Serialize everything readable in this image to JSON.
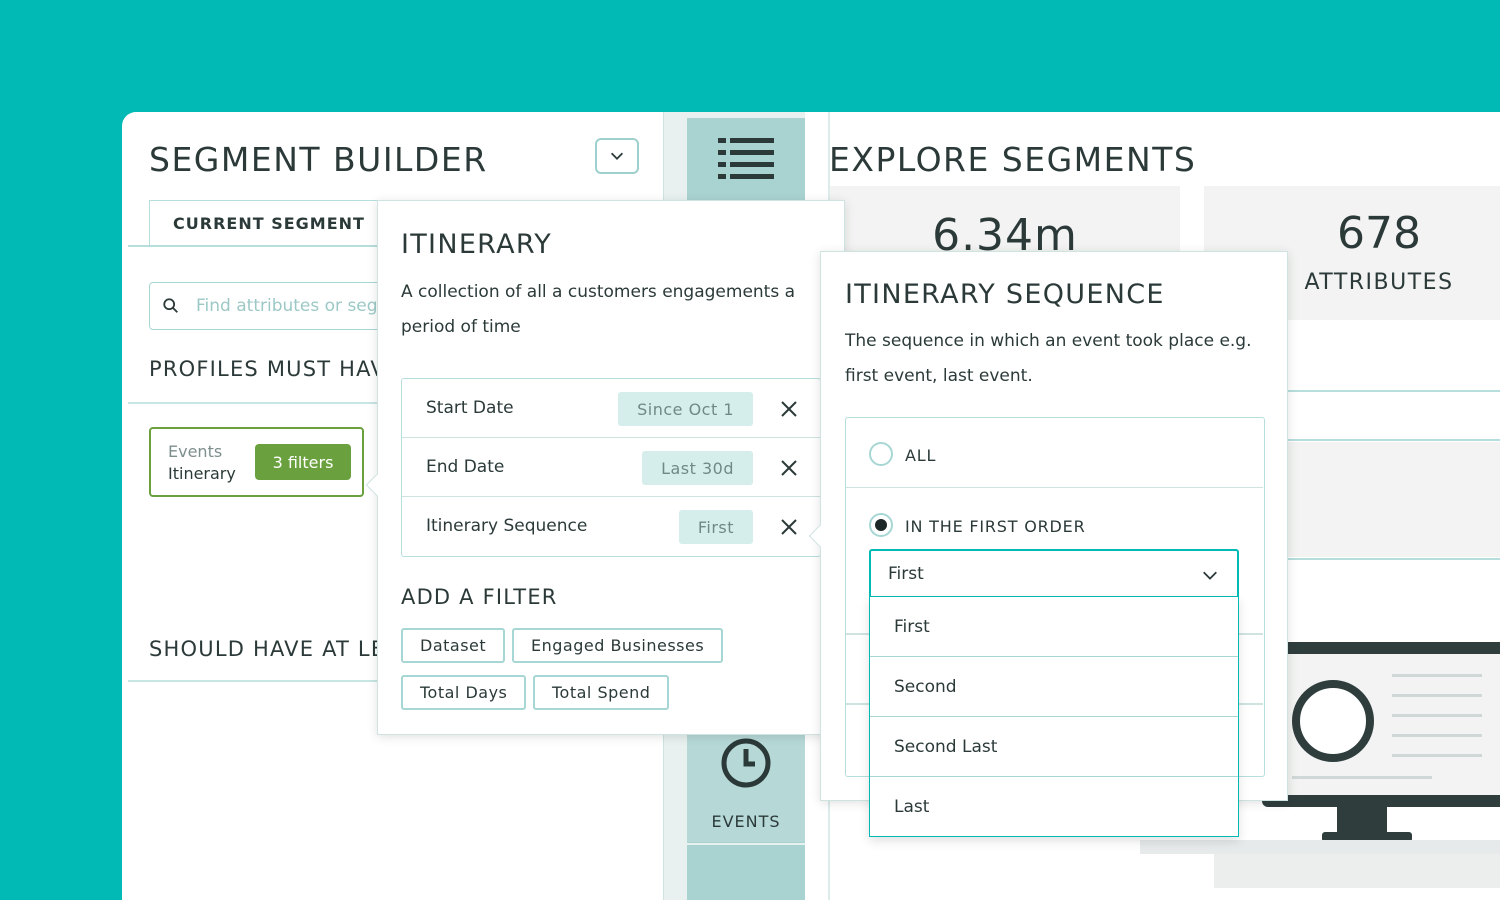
{
  "segment_builder": {
    "title": "SEGMENT BUILDER",
    "tab_current": "CURRENT SEGMENT",
    "search_placeholder": "Find attributes or segments",
    "section_must": "PROFILES MUST HAVE",
    "section_should": "SHOULD HAVE AT LEAST",
    "chip": {
      "line1": "Events",
      "line2": "Itinerary",
      "badge": "3 filters"
    }
  },
  "rail": {
    "events_label": "EVENTS"
  },
  "explore": {
    "title": "EXPLORE SEGMENTS",
    "stat1_value": "6.34m",
    "stat2_value": "678",
    "stat2_label": "ATTRIBUTES"
  },
  "itinerary_popover": {
    "title": "ITINERARY",
    "description": "A collection of all a customers engagements a period of time",
    "filters": [
      {
        "label": "Start Date",
        "value": "Since Oct 1"
      },
      {
        "label": "End Date",
        "value": "Last 30d"
      },
      {
        "label": "Itinerary Sequence",
        "value": "First"
      }
    ],
    "add_filter_title": "ADD A FILTER",
    "add_filter_buttons": [
      "Dataset",
      "Engaged Businesses",
      "Total Days",
      "Total Spend"
    ]
  },
  "sequence_popover": {
    "title": "ITINERARY SEQUENCE",
    "description": "The sequence in which an event took place e.g. first event, last event.",
    "options": [
      {
        "label": "ALL",
        "selected": false
      },
      {
        "label": "IN THE FIRST ORDER",
        "selected": true
      }
    ],
    "select_value": "First",
    "menu_items": [
      "First",
      "Second",
      "Second Last",
      "Last"
    ]
  },
  "colors": {
    "background": "#01bab6",
    "accent_green": "#6aa13e",
    "rail": "#a9d3d1",
    "dark": "#2b3a39"
  }
}
